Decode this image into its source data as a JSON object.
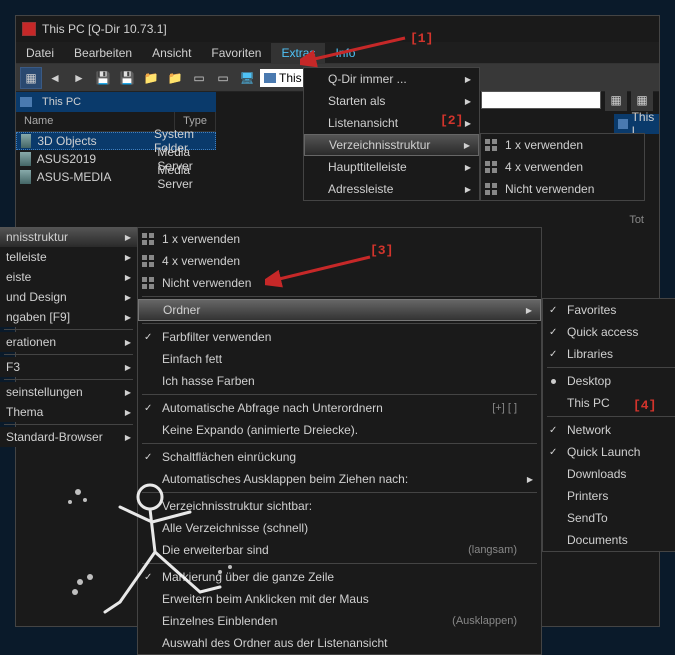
{
  "title": "This PC  [Q-Dir 10.73.1]",
  "menubar": [
    "Datei",
    "Bearbeiten",
    "Ansicht",
    "Favoriten",
    "Extras",
    "Info"
  ],
  "toolbar_addr": "This",
  "tab_left": "This PC",
  "tab_right": "This I",
  "columns": {
    "name": "Name",
    "type": "Type"
  },
  "files": [
    {
      "name": "3D Objects",
      "type": "System Folder"
    },
    {
      "name": "ASUS2019",
      "type": "Media Server"
    },
    {
      "name": "ASUS-MEDIA",
      "type": "Media Server"
    }
  ],
  "extras_menu": [
    {
      "label": "Q-Dir immer ...",
      "arrow": true
    },
    {
      "label": "Starten als",
      "arrow": true
    },
    {
      "label": "Listenansicht",
      "arrow": true
    },
    {
      "label": "Verzeichnisstruktur",
      "arrow": true,
      "hl": true
    },
    {
      "label": "Haupttitelleiste",
      "arrow": true
    },
    {
      "label": "Adressleiste",
      "arrow": true
    }
  ],
  "verz_submenu": [
    {
      "label": "1 x verwenden",
      "icon": "grid"
    },
    {
      "label": "4 x verwenden",
      "icon": "grid"
    },
    {
      "label": "Nicht verwenden",
      "icon": "grid"
    }
  ],
  "left_strip": [
    {
      "label": "nnisstruktur",
      "arrow": true,
      "hl": true
    },
    {
      "label": "telleiste",
      "arrow": true
    },
    {
      "label": "eiste",
      "arrow": true
    },
    {
      "label": "und Design",
      "arrow": true
    },
    {
      "label": "ngaben    [F9]",
      "arrow": true
    },
    {
      "label": ""
    },
    {
      "label": "erationen",
      "arrow": true
    },
    {
      "label": ""
    },
    {
      "label": "F3",
      "arrow": true
    },
    {
      "label": ""
    },
    {
      "label": "seinstellungen",
      "arrow": true
    },
    {
      "label": "Thema",
      "arrow": true
    },
    {
      "label": ""
    },
    {
      "label": "Standard-Browser",
      "arrow": true
    }
  ],
  "big_submenu_top": [
    {
      "label": "1 x verwenden",
      "icon": "grid"
    },
    {
      "label": "4 x verwenden",
      "icon": "grid"
    },
    {
      "label": "Nicht verwenden",
      "icon": "grid"
    }
  ],
  "ordner_label": "Ordner",
  "big_submenu": [
    {
      "label": "Farbfilter verwenden",
      "check": true
    },
    {
      "label": "Einfach fett"
    },
    {
      "label": "Ich hasse Farben"
    },
    {
      "sep": true
    },
    {
      "label": "Automatische Abfrage nach Unterordnern",
      "check": true,
      "right": "[+] [ ]"
    },
    {
      "label": "Keine Expando (animierte Dreiecke)."
    },
    {
      "sep": true
    },
    {
      "label": "Schaltflächen einrückung",
      "check": true
    },
    {
      "label": "Automatisches Ausklappen beim Ziehen nach:",
      "arrow": true
    },
    {
      "sep": true
    },
    {
      "label": "Verzeichnisstruktur sichtbar:"
    },
    {
      "label": "Alle Verzeichnisse (schnell)"
    },
    {
      "label": "Die erweiterbar sind",
      "right": "(langsam)"
    },
    {
      "sep": true
    },
    {
      "label": "Markierung über die ganze Zeile",
      "check": true
    },
    {
      "label": "Erweitern beim Anklicken mit der Maus"
    },
    {
      "label": "Einzelnes Einblenden",
      "right": "(Ausklappen)"
    },
    {
      "label": "Auswahl des Ordner aus der Listenansicht"
    }
  ],
  "ordner_submenu": [
    {
      "label": "Favorites",
      "check": true
    },
    {
      "label": "Quick access",
      "check": true
    },
    {
      "label": "Libraries",
      "check": true
    },
    {
      "sep": true
    },
    {
      "label": "Desktop",
      "radio": true
    },
    {
      "label": "This PC"
    },
    {
      "sep": true
    },
    {
      "label": "Network",
      "check": true
    },
    {
      "label": "Quick Launch",
      "check": true
    },
    {
      "label": "Downloads"
    },
    {
      "label": "Printers"
    },
    {
      "label": "SendTo"
    },
    {
      "label": "Documents"
    }
  ],
  "annotations": {
    "a1": "[1]",
    "a2": "[2]",
    "a3": "[3]",
    "a4": "[4]"
  },
  "footer_total": "Tot"
}
